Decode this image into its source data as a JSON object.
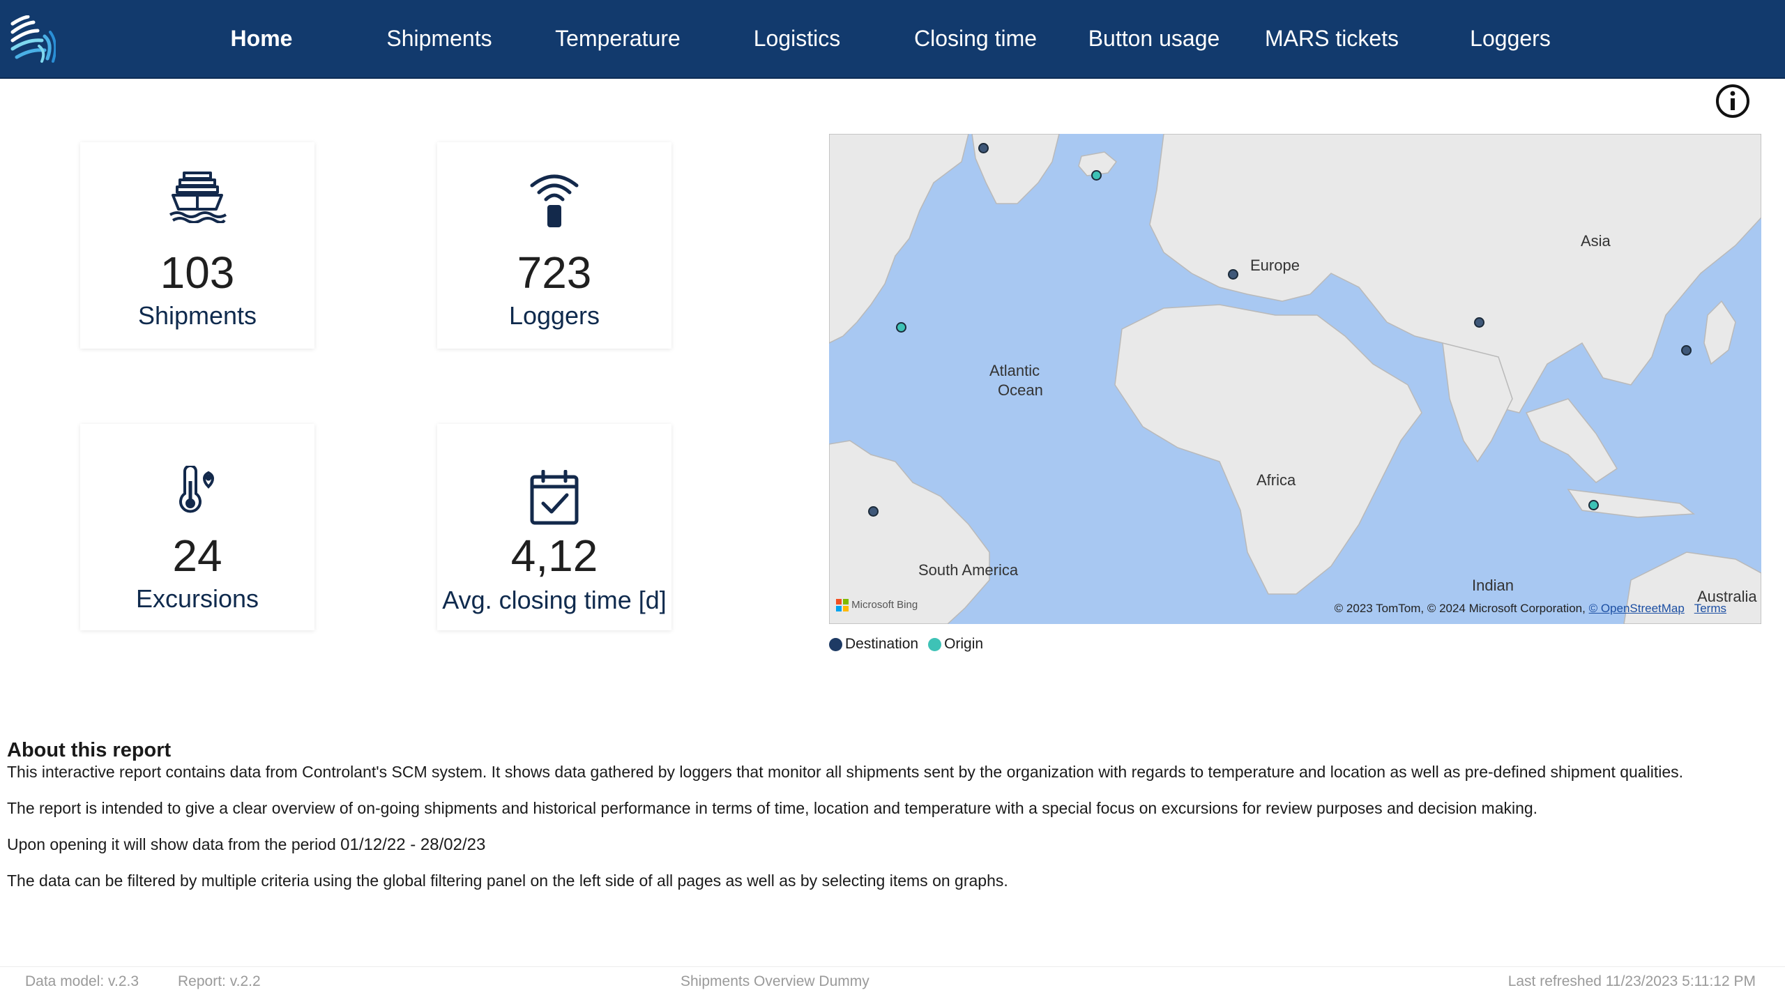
{
  "nav": {
    "items": [
      {
        "label": "Home",
        "active": true
      },
      {
        "label": "Shipments"
      },
      {
        "label": "Temperature"
      },
      {
        "label": "Logistics"
      },
      {
        "label": "Closing time"
      },
      {
        "label": "Button usage"
      },
      {
        "label": "MARS tickets"
      },
      {
        "label": "Loggers"
      }
    ]
  },
  "kpis": {
    "shipments": {
      "value": "103",
      "label": "Shipments",
      "icon": "ship-icon"
    },
    "loggers": {
      "value": "723",
      "label": "Loggers",
      "icon": "signal-logger-icon"
    },
    "excursions": {
      "value": "24",
      "label": "Excursions",
      "icon": "thermometer-location-icon"
    },
    "closing": {
      "value": "4,12",
      "label": "Avg. closing time [d]",
      "icon": "calendar-check-icon"
    }
  },
  "map": {
    "labels": {
      "europe": "Europe",
      "asia": "Asia",
      "atlantic_1": "Atlantic",
      "atlantic_2": "Ocean",
      "africa": "Africa",
      "south_america": "South America",
      "indian": "Indian",
      "australia": "Australia"
    },
    "brand": "Microsoft Bing",
    "copyright": "© 2023 TomTom, © 2024 Microsoft Corporation,",
    "osm_link": "© OpenStreetMap",
    "terms_link": "Terms",
    "colors": {
      "destination": "#1e3a64",
      "origin": "#3ec2b6"
    }
  },
  "legend": {
    "destination": "Destination",
    "origin": "Origin"
  },
  "about": {
    "title": "About this report",
    "p1": "This interactive report contains data from Controlant's SCM system. It shows data gathered by loggers that monitor all shipments sent by the organization with regards to temperature and location as well as pre-defined shipment qualities.",
    "p2": "The report is intended to give a clear overview of on-going shipments and historical performance in terms of time, location and temperature with a special focus on excursions for review purposes and decision making.",
    "p3_prefix": "Upon opening it will show data from the period",
    "p3_period": "01/12/22 - 28/02/23",
    "p4": "The data can be filtered by multiple criteria using the global filtering panel on the left side of all pages as well as by selecting items on graphs."
  },
  "footer": {
    "data_model": "Data model: v.2.3",
    "report": "Report: v.2.2",
    "name": "Shipments Overview Dummy",
    "refreshed": "Last refreshed 11/23/2023 5:11:12 PM"
  }
}
